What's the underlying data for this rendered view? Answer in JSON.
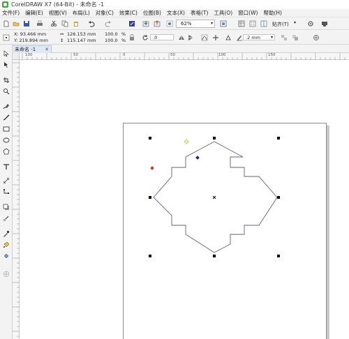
{
  "window": {
    "title": "CorelDRAW X7 (64-Bit) - 未命名 -1"
  },
  "menu": {
    "items": [
      "文件(F)",
      "编辑(E)",
      "视图(V)",
      "布局(L)",
      "对象(C)",
      "效果(C)",
      "位图(B)",
      "文本(X)",
      "表格(T)",
      "工具(O)",
      "窗口(W)",
      "帮助(H)"
    ]
  },
  "toolbar": {
    "zoom": "62%",
    "snap_label": "贴齐(T)"
  },
  "properties": {
    "x": "X: 93.466 mm",
    "y": "Y: 219.894 mm",
    "width": "126.153 mm",
    "height": "115.147 mm",
    "scale_x": "100.0",
    "scale_y": "100.0",
    "percent": "%",
    "rotation": ".0",
    "outline_width": ".2 mm"
  },
  "document": {
    "tab_label": "未命名 -1"
  },
  "ruler": {
    "labels": [
      "100",
      "50",
      "0",
      "50",
      "100",
      "150"
    ]
  },
  "colors": {
    "accent": "#48a548",
    "handle_red": "#c0392b",
    "handle_green": "#9acd32",
    "handle_navy": "#1f2a6b",
    "outline": "#6b5a7a"
  }
}
